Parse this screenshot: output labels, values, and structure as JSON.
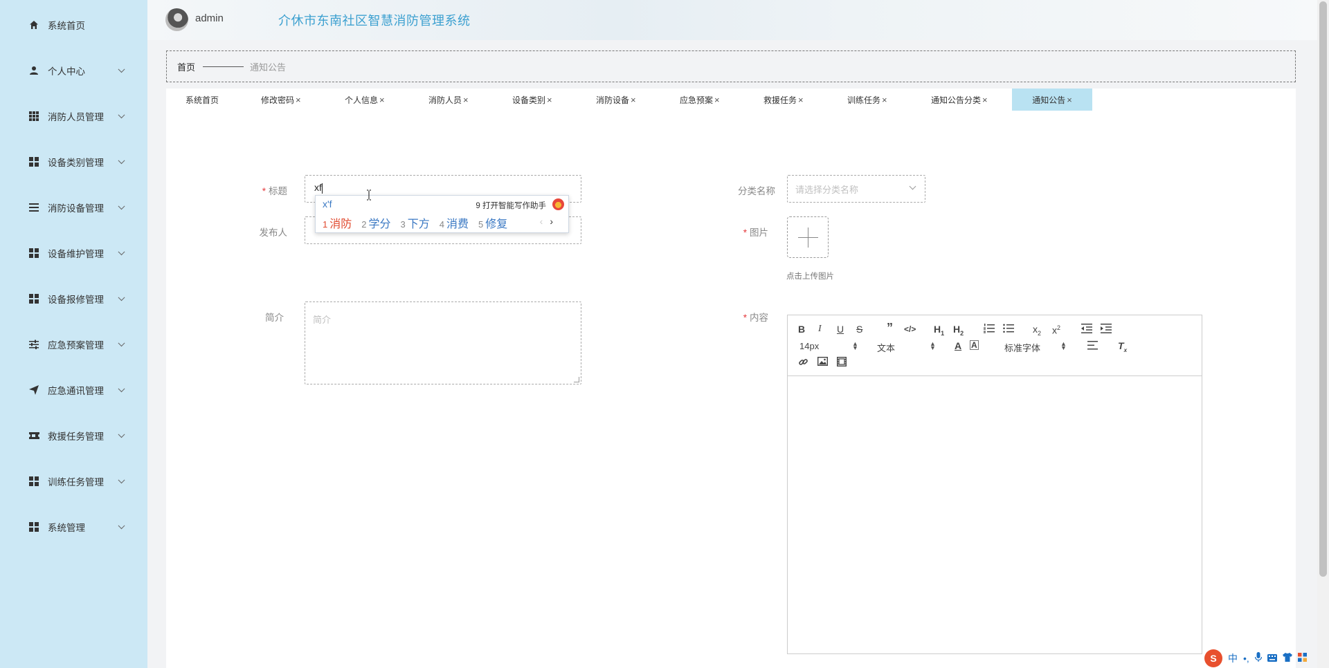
{
  "sidebar": {
    "items": [
      {
        "label": "系统首页",
        "icon": "home-icon"
      },
      {
        "label": "个人中心",
        "icon": "user-icon"
      },
      {
        "label": "消防人员管理",
        "icon": "grid-icon"
      },
      {
        "label": "设备类别管理",
        "icon": "apps-icon"
      },
      {
        "label": "消防设备管理",
        "icon": "list-icon"
      },
      {
        "label": "设备维护管理",
        "icon": "apps-icon"
      },
      {
        "label": "设备报修管理",
        "icon": "apps-icon"
      },
      {
        "label": "应急预案管理",
        "icon": "sliders-icon"
      },
      {
        "label": "应急通讯管理",
        "icon": "send-icon"
      },
      {
        "label": "救援任务管理",
        "icon": "ticket-icon"
      },
      {
        "label": "训练任务管理",
        "icon": "apps-icon"
      },
      {
        "label": "系统管理",
        "icon": "apps-icon"
      }
    ]
  },
  "header": {
    "username": "admin",
    "title": "介休市东南社区智慧消防管理系统"
  },
  "breadcrumb": {
    "home": "首页",
    "current": "通知公告"
  },
  "tabs": [
    {
      "label": "系统首页",
      "closable": false
    },
    {
      "label": "修改密码",
      "closable": true
    },
    {
      "label": "个人信息",
      "closable": true
    },
    {
      "label": "消防人员",
      "closable": true
    },
    {
      "label": "设备类别",
      "closable": true
    },
    {
      "label": "消防设备",
      "closable": true
    },
    {
      "label": "应急预案",
      "closable": true
    },
    {
      "label": "救援任务",
      "closable": true
    },
    {
      "label": "训练任务",
      "closable": true
    },
    {
      "label": "通知公告分类",
      "closable": true
    },
    {
      "label": "通知公告",
      "closable": true,
      "active": true
    }
  ],
  "close_glyph": "×",
  "form": {
    "title_label": "标题",
    "title_value": "xf",
    "publisher_label": "发布人",
    "summary_label": "简介",
    "summary_placeholder": "简介",
    "category_label": "分类名称",
    "category_placeholder": "请选择分类名称",
    "image_label": "图片",
    "upload_tip": "点击上传图片",
    "content_label": "内容"
  },
  "ime_popup": {
    "pinyin": "x'f",
    "assistant": "9 打开智能写作助手",
    "candidates": [
      {
        "n": "1",
        "text": "消防"
      },
      {
        "n": "2",
        "text": "学分"
      },
      {
        "n": "3",
        "text": "下方"
      },
      {
        "n": "4",
        "text": "消费"
      },
      {
        "n": "5",
        "text": "修复"
      }
    ],
    "prev": "‹",
    "next": "›"
  },
  "editor": {
    "font_size": "14px",
    "header_type": "文本",
    "font_family": "标准字体"
  },
  "ime_status": {
    "logo": "S",
    "mode": "中",
    "punct": "•,"
  },
  "colors": {
    "sidebar_bg": "#cce8f5",
    "title_color": "#3ca0d0",
    "active_tab_bg": "#b9e2f2",
    "required": "#e4393c"
  }
}
